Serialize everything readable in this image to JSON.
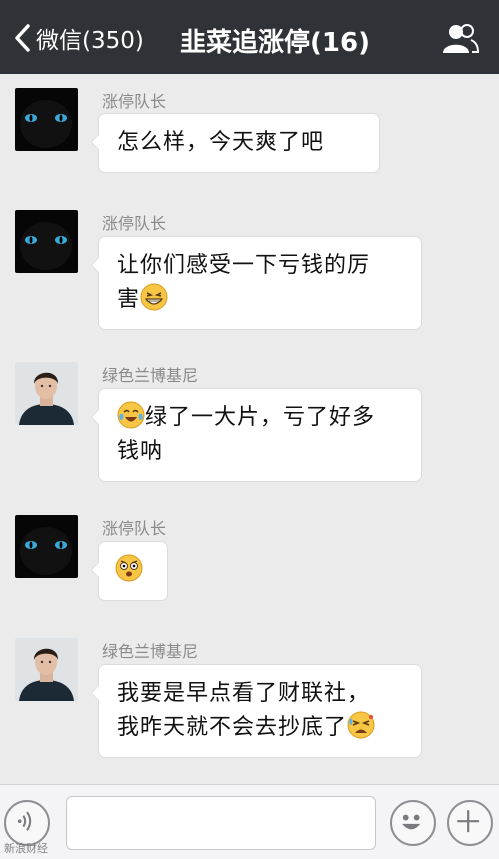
{
  "navbar": {
    "back_label": "微信(350)",
    "title": "韭菜追涨停(16)",
    "icons": {
      "back": "chevron-left-icon",
      "members": "group-members-icon"
    }
  },
  "messages": [
    {
      "sender": "涨停队长",
      "avatar": "black-cat-avatar",
      "lines": [
        "怎么样，今天爽了吧"
      ],
      "emoji": null
    },
    {
      "sender": "涨停队长",
      "avatar": "black-cat-avatar",
      "lines": [
        "让你们感受一下亏钱的厉",
        "害"
      ],
      "emoji": "grin-emoji"
    },
    {
      "sender": "绿色兰博基尼",
      "avatar": "man-portrait-avatar",
      "lines": [
        "绿了一大片，亏了好多",
        "钱呐"
      ],
      "emoji": "crying-laugh-emoji"
    },
    {
      "sender": "涨停队长",
      "avatar": "black-cat-avatar",
      "lines": [],
      "emoji": "shocked-emoji"
    },
    {
      "sender": "绿色兰博基尼",
      "avatar": "man-portrait-avatar",
      "lines": [
        "我要是早点看了财联社，",
        "我昨天就不会去抄底了"
      ],
      "emoji": "upset-emoji"
    }
  ],
  "input_bar": {
    "placeholder": "",
    "value": "",
    "icons": {
      "voice": "voice-icon",
      "emoji": "smiley-icon",
      "more": "plus-icon"
    }
  },
  "watermark": "新浪财经"
}
